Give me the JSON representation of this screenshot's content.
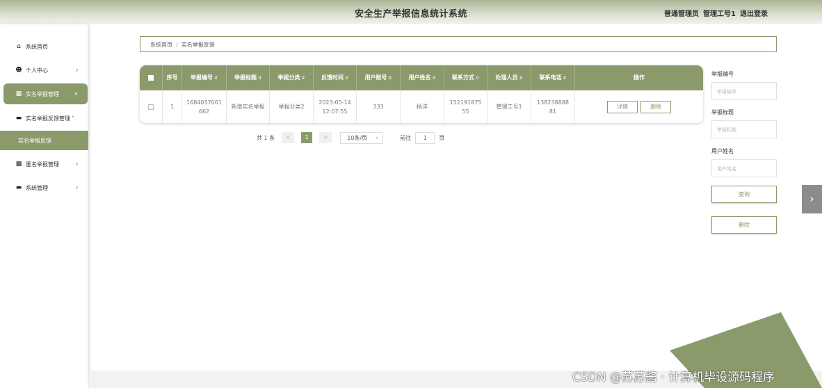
{
  "header": {
    "title": "安全生产举报信息统计系统",
    "role": "普通管理员",
    "user": "管理工号1",
    "logout": "退出登录"
  },
  "sidebar": {
    "items": [
      {
        "label": "系统首页",
        "icon": "home-icon"
      },
      {
        "label": "个人中心",
        "icon": "user-icon"
      },
      {
        "label": "实名举报管理",
        "icon": "grid-icon"
      },
      {
        "label": "实名举报反馈管理",
        "icon": "monitor-icon"
      },
      {
        "label": "实名举报反馈"
      },
      {
        "label": "匿名举报管理",
        "icon": "chart-icon"
      },
      {
        "label": "系统管理",
        "icon": "monitor-icon"
      }
    ]
  },
  "breadcrumb": {
    "home": "系统首页",
    "separator": "/",
    "current": "实名举报反馈"
  },
  "table": {
    "headers": [
      "序号",
      "举报编号",
      "举报标题",
      "举报分类",
      "反馈时间",
      "用户账号",
      "用户姓名",
      "联系方式",
      "处理人员",
      "联系电话",
      "操作"
    ],
    "rows": [
      {
        "index": "1",
        "report_no": "1684037061662",
        "report_title": "新增实名举报",
        "category": "举报分类2",
        "feedback_time": "2023-05-14 12:07:55",
        "account": "333",
        "name": "杨洋",
        "contact": "15219187555",
        "handler": "管理工号1",
        "phone": "13823888881",
        "detail_label": "详情",
        "delete_label": "删除"
      }
    ]
  },
  "pagination": {
    "total": "共 1 条",
    "prev": "<",
    "current_page": "1",
    "next": ">",
    "page_size": "10条/页",
    "goto_prefix": "前往",
    "goto_value": "1",
    "goto_suffix": "页"
  },
  "search": {
    "fields": [
      {
        "label": "举报编号",
        "placeholder": "举报编号"
      },
      {
        "label": "举报标题",
        "placeholder": "举报标题"
      },
      {
        "label": "用户姓名",
        "placeholder": "用户姓名"
      }
    ],
    "query_label": "查询",
    "delete_label": "删除"
  },
  "watermark": "CSDN @苏苏酱 · 计算机毕设源码程序",
  "colors": {
    "accent": "#8a9a6a",
    "header_gradient_top": "#a9b596"
  }
}
